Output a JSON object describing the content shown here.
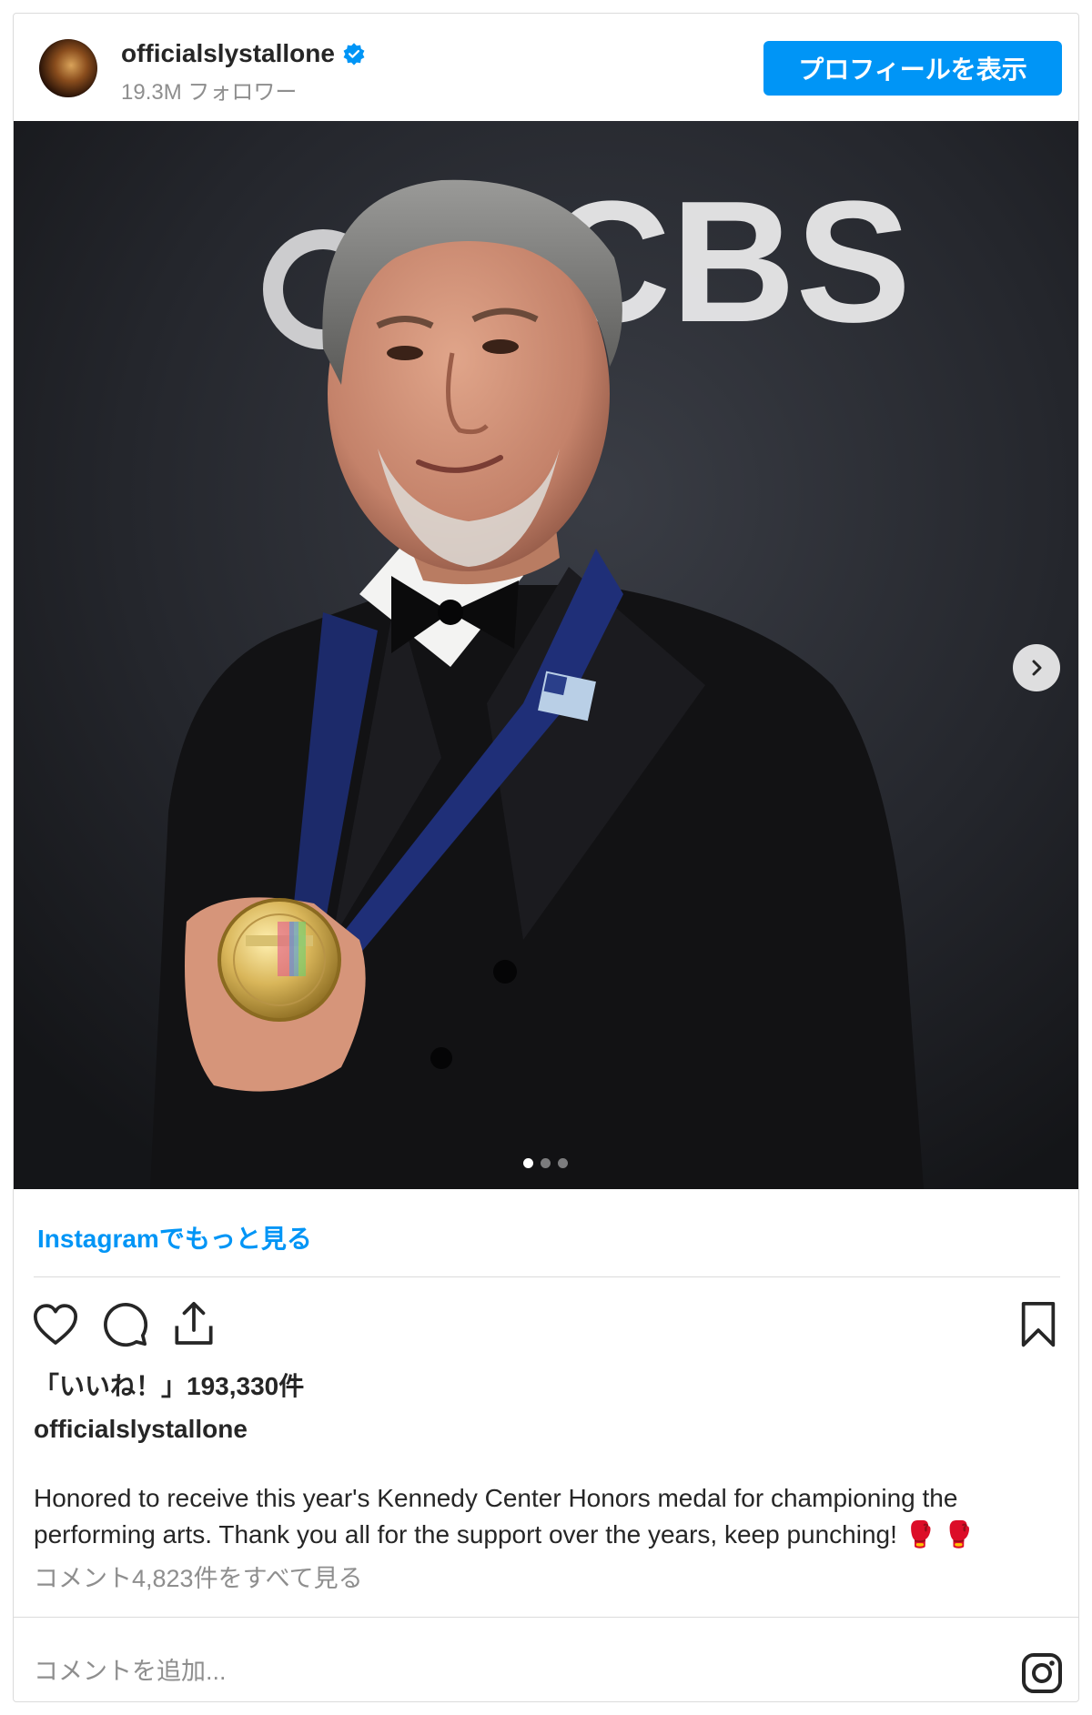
{
  "header": {
    "username": "officialslystallone",
    "followers": "19.3M フォロワー",
    "profile_button": "プロフィールを表示"
  },
  "post": {
    "more_link": "Instagramでもっと見る",
    "likes": "「いいね！」193,330件",
    "caption_user": "officialslystallone",
    "caption": "Honored to receive this year's Kennedy Center Honors medal for championing the performing arts. Thank you all for the support over the years, keep punching! 🥊 🥊",
    "view_comments": "コメント4,823件をすべて見る",
    "comment_placeholder": "コメントを追加...",
    "carousel_total": 3,
    "carousel_active": 1
  },
  "backdrop_text": "CBS",
  "colors": {
    "accent": "#0095f6",
    "text": "#262626",
    "muted": "#8e8e8e",
    "border": "#dbdbdb"
  }
}
